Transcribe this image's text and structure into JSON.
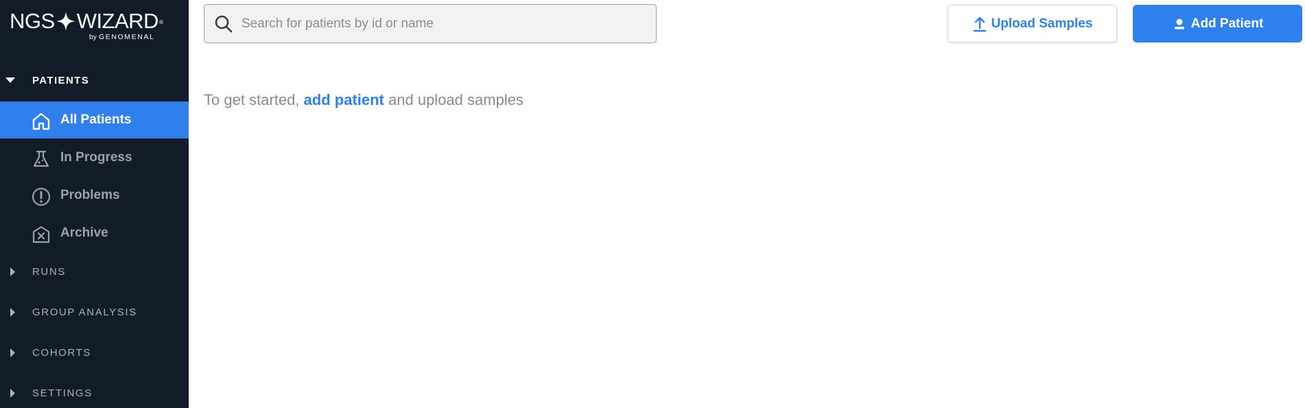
{
  "brand": {
    "name_left": "NGS",
    "name_right": "WIZARD",
    "registered": "®",
    "by": "by",
    "company": "GENOMENAL"
  },
  "sidebar": {
    "sections": [
      {
        "label": "PATIENTS",
        "expanded": true
      },
      {
        "label": "RUNS",
        "expanded": false
      },
      {
        "label": "GROUP ANALYSIS",
        "expanded": false
      },
      {
        "label": "COHORTS",
        "expanded": false
      },
      {
        "label": "SETTINGS",
        "expanded": false
      }
    ],
    "patient_items": [
      {
        "label": "All Patients",
        "icon": "home-icon",
        "active": true
      },
      {
        "label": "In Progress",
        "icon": "flask-icon",
        "active": false
      },
      {
        "label": "Problems",
        "icon": "exclamation-circle-icon",
        "active": false
      },
      {
        "label": "Archive",
        "icon": "archive-x-icon",
        "active": false
      }
    ]
  },
  "header": {
    "search_placeholder": "Search for patients by id or name",
    "search_value": "",
    "upload_label": "Upload Samples",
    "add_label": "Add Patient"
  },
  "main": {
    "empty_prefix": "To get started,",
    "empty_link": "add patient",
    "empty_suffix": "and upload samples"
  },
  "colors": {
    "sidebar_bg": "#121c28",
    "accent": "#2f80ed",
    "muted_text": "#8a8a8a"
  }
}
